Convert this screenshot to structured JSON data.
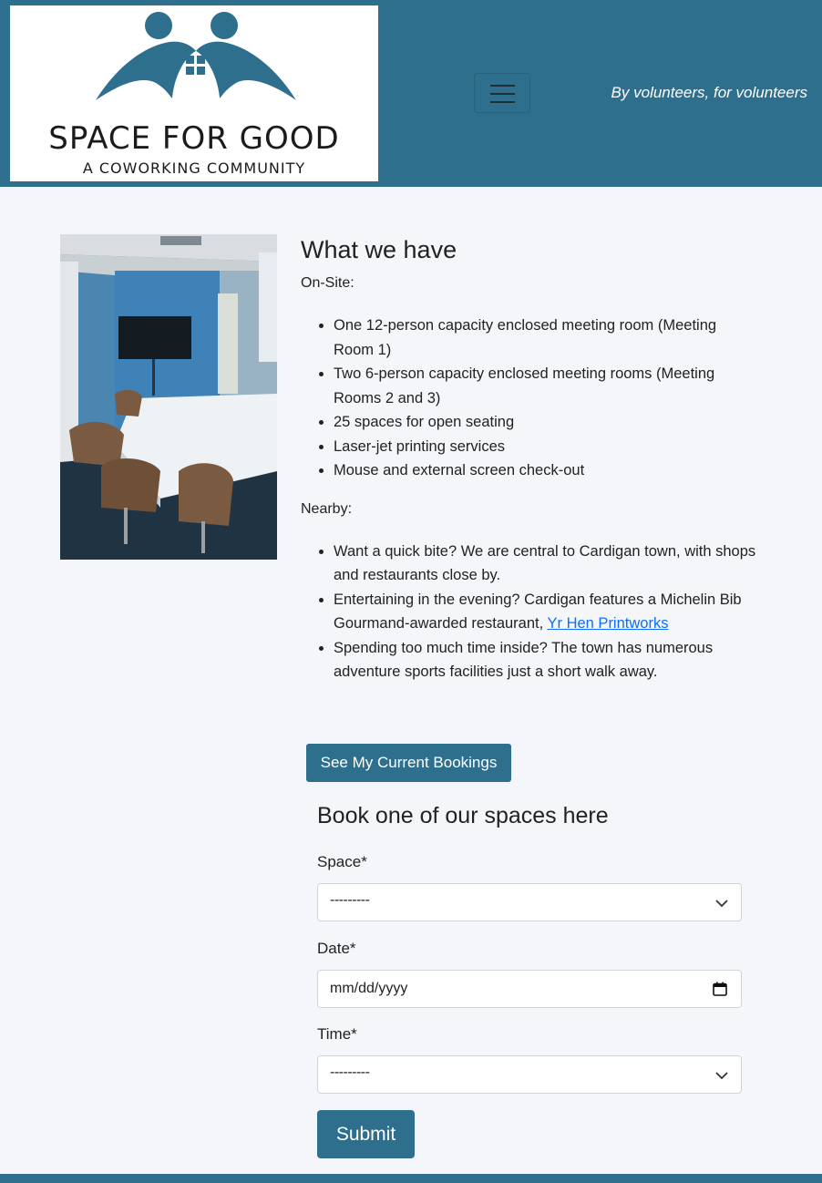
{
  "header": {
    "logo_title": "SPACE FOR GOOD",
    "logo_subtitle": "A COWORKING COMMUNITY",
    "tagline": "By volunteers, for volunteers",
    "brand_color": "#2f6f8e"
  },
  "about": {
    "heading": "What we have",
    "onsite_label": "On-Site:",
    "onsite_items": [
      "One 12-person capacity enclosed meeting room (Meeting Room 1)",
      "Two 6-person capacity enclosed meeting rooms (Meeting Rooms 2 and 3)",
      "25 spaces for open seating",
      "Laser-jet printing services",
      "Mouse and external screen check-out"
    ],
    "nearby_label": "Nearby:",
    "nearby_items": [
      "Want a quick bite? We are central to Cardigan town, with shops and restaurants close by.",
      "Entertaining in the evening? Cardigan features a Michelin Bib Gourmand-awarded restaurant, ",
      "Spending too much time inside? The town has numerous adventure sports facilities just a short walk away."
    ],
    "nearby_link_text": "Yr Hen Printworks"
  },
  "bookings_button": "See My Current Bookings",
  "form": {
    "title": "Book one of our spaces here",
    "space_label": "Space*",
    "space_value": "---------",
    "date_label": "Date*",
    "date_value": "mm/dd/yyyy",
    "time_label": "Time*",
    "time_value": "---------",
    "submit_label": "Submit"
  }
}
